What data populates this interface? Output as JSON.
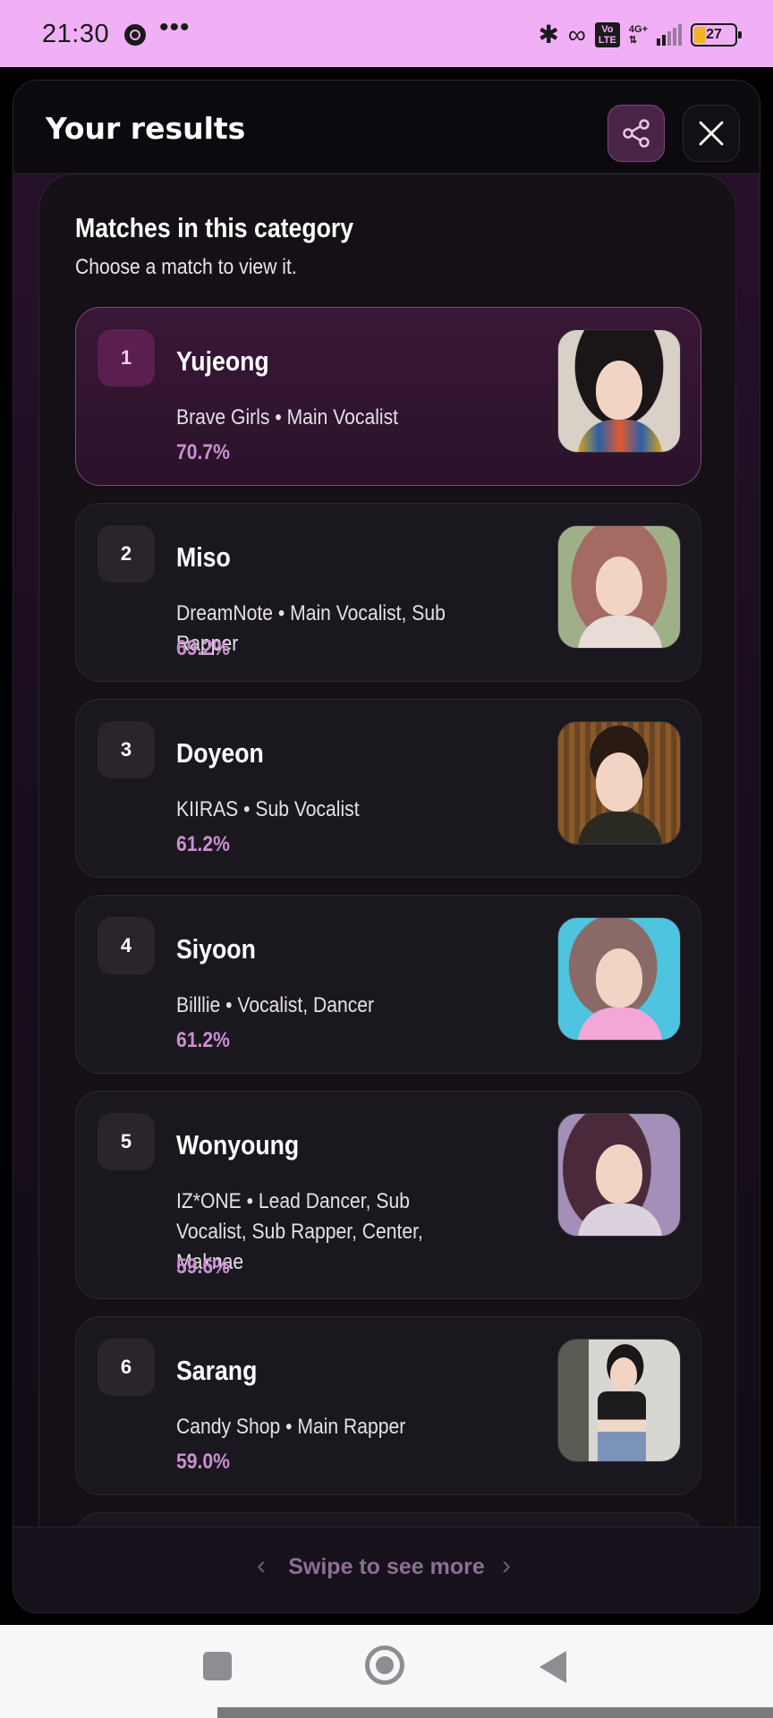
{
  "status_bar": {
    "time": "21:30",
    "more": "•••",
    "battery_level": "27",
    "network": "4G+",
    "volte": "Vo LTE"
  },
  "header": {
    "title": "Your results",
    "share_icon": "share-icon",
    "close_icon": "close-icon"
  },
  "panel": {
    "title": "Matches in this category",
    "subtitle": "Choose a match to view it."
  },
  "matches": [
    {
      "rank": "1",
      "name": "Yujeong",
      "detail": "Brave Girls • Main Vocalist",
      "percent": "70.7%",
      "selected": true
    },
    {
      "rank": "2",
      "name": "Miso",
      "detail": "DreamNote • Main Vocalist, Sub Rapper",
      "percent": "69.2%"
    },
    {
      "rank": "3",
      "name": "Doyeon",
      "detail": "KIIRAS • Sub Vocalist",
      "percent": "61.2%"
    },
    {
      "rank": "4",
      "name": "Siyoon",
      "detail": "Billlie • Vocalist, Dancer",
      "percent": "61.2%"
    },
    {
      "rank": "5",
      "name": "Wonyoung",
      "detail": "IZ*ONE • Lead Dancer, Sub Vocalist, Sub Rapper, Center, Maknae",
      "percent": "59.6%"
    },
    {
      "rank": "6",
      "name": "Sarang",
      "detail": "Candy Shop • Main Rapper",
      "percent": "59.0%"
    }
  ],
  "footer": {
    "swipe_text": "Swipe to see more",
    "left_chevron": "‹",
    "right_chevron": "›"
  },
  "colors": {
    "accent": "#c98fd0",
    "status_bar_bg": "#f1aff6",
    "sheet_bg": "#0d0a0f"
  }
}
